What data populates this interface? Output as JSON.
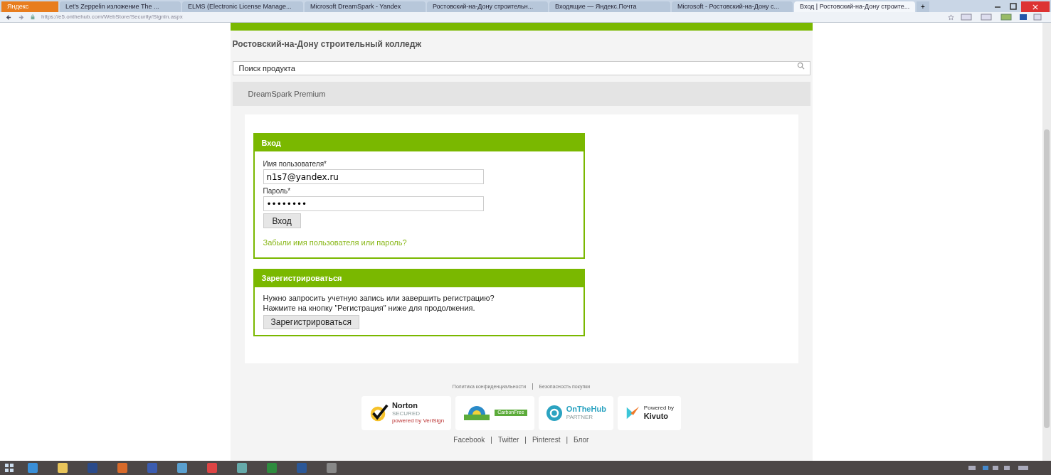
{
  "browser": {
    "menu_button": "Яндекс",
    "tabs": [
      {
        "title": "Let's Zeppelin изложение The ...",
        "selected": false
      },
      {
        "title": "ELMS (Electronic License Manage...",
        "selected": false
      },
      {
        "title": "Microsoft DreamSpark - Yandex",
        "selected": false
      },
      {
        "title": "Ростовский-на-Дону строительн...",
        "selected": false
      },
      {
        "title": "Входящие — Яндекс.Почта",
        "selected": false
      },
      {
        "title": "Microsoft - Ростовский-на-Дону с...",
        "selected": false
      },
      {
        "title": "Вход | Ростовский-на-Дону строите...",
        "selected": true
      }
    ],
    "new_tab": "+",
    "address": "https://e5.onthehub.com/WebStore/Security/SignIn.aspx"
  },
  "page": {
    "college": "Ростовский-на-Дону строительный колледж",
    "search": {
      "placeholder": "Поиск продукта"
    },
    "product_bar": "DreamSpark Premium",
    "login": {
      "title": "Вход",
      "username_label": "Имя пользователя*",
      "username": "n1s7@yandex.ru",
      "password_label": "Пароль*",
      "password": "••••••••",
      "button": "Вход",
      "forgot_link": "Забыли имя пользователя или пароль?"
    },
    "register": {
      "title": "Зарегистрироваться",
      "text": "Нужно запросить учетную запись или завершить регистрацию? Нажмите на кнопку \"Регистрация\" ниже для продолжения.",
      "button": "Зарегистрироваться"
    },
    "policy_links": [
      "Политика конфиденциальности",
      "Безопасность покупки"
    ],
    "policy_separators": [
      "|"
    ],
    "badges": [
      {
        "kind": "norton",
        "title": "Norton",
        "subtitle": "SECURED",
        "note": "powered by VeriSign"
      },
      {
        "kind": "carbon",
        "title": "CarbonFree"
      },
      {
        "kind": "onthehub",
        "title": "OnTheHub",
        "subtitle": "PARTNER"
      },
      {
        "kind": "kivuto",
        "title": "Kivuto",
        "note": "Powered by"
      }
    ],
    "social_links": [
      "Facebook",
      "Twitter",
      "Pinterest",
      "Блог"
    ],
    "social_separators": [
      "|",
      "|",
      "|"
    ]
  }
}
